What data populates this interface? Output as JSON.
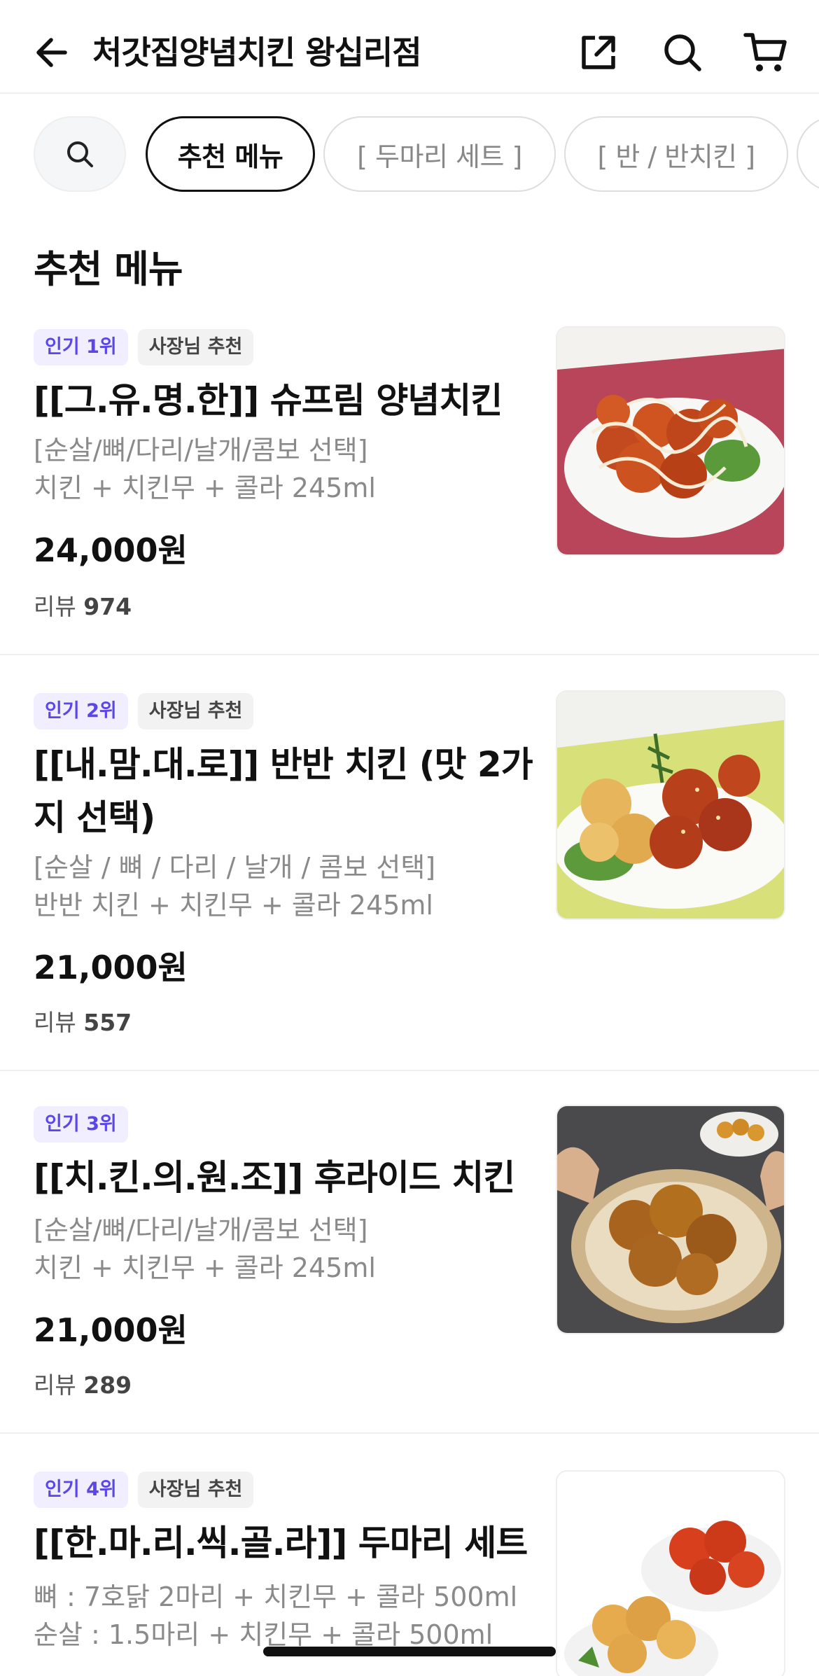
{
  "header": {
    "title": "처갓집양념치킨 왕십리점",
    "back_icon": "arrow-left-icon",
    "share_icon": "share-icon",
    "search_icon": "search-icon",
    "cart_icon": "cart-icon"
  },
  "categories": {
    "search_icon": "search-icon",
    "items": [
      {
        "label": "추천 메뉴",
        "active": true
      },
      {
        "label": "[ 두마리 세트 ]",
        "active": false
      },
      {
        "label": "[ 반 / 반치킨 ]",
        "active": false
      },
      {
        "label": "",
        "active": false
      }
    ]
  },
  "section": {
    "title": "추천 메뉴"
  },
  "menu": [
    {
      "badges": [
        "인기 1위",
        "사장님 추천"
      ],
      "name": "[[그.유.명.한]] 슈프림 양념치킨",
      "desc1": "[순살/뼈/다리/날개/콤보 선택]",
      "desc2": "치킨 + 치킨무 + 콜라 245ml",
      "price": "24,000원",
      "review_label": "리뷰",
      "review_count": "974"
    },
    {
      "badges": [
        "인기 2위",
        "사장님 추천"
      ],
      "name": "[[내.맘.대.로]] 반반 치킨 (맛  2가지 선택)",
      "desc1": "[순살 / 뼈 / 다리 / 날개 / 콤보 선택]",
      "desc2": "반반 치킨 + 치킨무 + 콜라 245ml",
      "price": "21,000원",
      "review_label": "리뷰",
      "review_count": "557"
    },
    {
      "badges": [
        "인기 3위"
      ],
      "name": "[[치.킨.의.원.조]] 후라이드 치킨",
      "desc1": "[순살/뼈/다리/날개/콤보 선택]",
      "desc2": "치킨 + 치킨무 + 콜라 245ml",
      "price": "21,000원",
      "review_label": "리뷰",
      "review_count": "289"
    },
    {
      "badges": [
        "인기 4위",
        "사장님 추천"
      ],
      "name": "[[한.마.리.씩.골.라]] 두마리 세트",
      "desc1": "뼈 : 7호닭 2마리 + 치킨무 + 콜라 500ml",
      "desc2": "순살 : 1.5마리 + 치킨무 + 콜라 500ml"
    }
  ]
}
